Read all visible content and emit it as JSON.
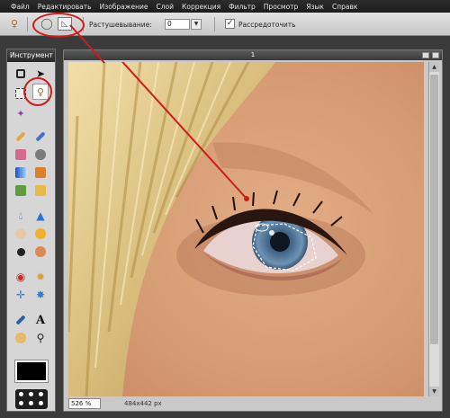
{
  "menu": [
    "Файл",
    "Редактировать",
    "Изображение",
    "Слой",
    "Коррекция",
    "Фильтр",
    "Просмотр",
    "Язык",
    "Справк"
  ],
  "options": {
    "feather_label": "Растушевывание:",
    "feather_value": "0",
    "smooth_checked": "✓",
    "smooth_label": "Рассредоточить"
  },
  "tools": {
    "title": "Инструмент"
  },
  "document": {
    "title": "1",
    "zoom": "526",
    "zoom_unit": "%",
    "dimensions": "484x442 px"
  },
  "colors": {
    "annotation_red": "#d11a1a",
    "foreground": "#000000"
  },
  "icons": [
    "lasso-icon",
    "polygon-lasso-icon",
    "magnetic-lasso-icon",
    "crop-icon",
    "move-icon",
    "marquee-icon",
    "magic-wand-icon",
    "pencil-icon",
    "brush-icon",
    "eraser-icon",
    "clone-icon",
    "gradient-icon",
    "bucket-icon",
    "heal-icon",
    "stamp-icon",
    "blur-icon",
    "sharpen-icon",
    "smudge-icon",
    "sponge-icon",
    "dodge-icon",
    "burn-icon",
    "red-eye-icon",
    "sparkle-icon",
    "color-replace-icon",
    "bloat-icon",
    "eyedropper-icon",
    "text-icon",
    "hand-icon",
    "zoom-icon"
  ]
}
